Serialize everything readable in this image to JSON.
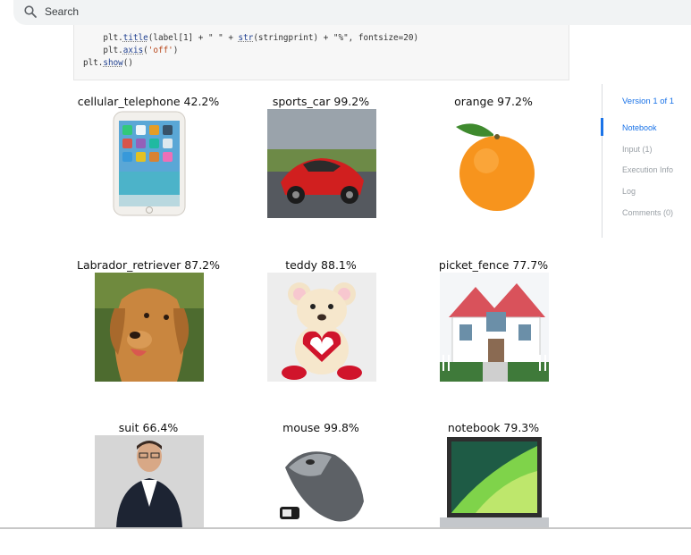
{
  "search": {
    "placeholder": "Search",
    "icon": "search-icon"
  },
  "code": {
    "line1": {
      "indent": "    ",
      "fn1": "plt.",
      "fn1b": "title",
      "rest1": "(label[1] + \" \" + ",
      "fn2": "str",
      "rest2": "(stringprint) + \"%\", fontsize=20)"
    },
    "line2": {
      "indent": "    ",
      "prefix": "plt.",
      "fn": "axis",
      "open": "(",
      "arg": "'off'",
      "close": ")"
    },
    "line3": {
      "prefix": "plt.",
      "fn": "show",
      "rest": "()"
    }
  },
  "predictions": [
    {
      "label": "cellular_telephone 42.2%",
      "image": "phone"
    },
    {
      "label": "sports_car 99.2%",
      "image": "car"
    },
    {
      "label": "orange 97.2%",
      "image": "orange"
    },
    {
      "label": "Labrador_retriever 87.2%",
      "image": "dog"
    },
    {
      "label": "teddy 88.1%",
      "image": "teddy"
    },
    {
      "label": "picket_fence 77.7%",
      "image": "house"
    },
    {
      "label": "suit 66.4%",
      "image": "person"
    },
    {
      "label": "mouse 99.8%",
      "image": "mouse"
    },
    {
      "label": "notebook 79.3%",
      "image": "laptop"
    }
  ],
  "nav": {
    "version": "Version 1 of 1",
    "items": [
      {
        "label": "Notebook",
        "active": true
      },
      {
        "label": "Input (1)",
        "active": false
      },
      {
        "label": "Execution Info",
        "active": false
      },
      {
        "label": "Log",
        "active": false
      },
      {
        "label": "Comments (0)",
        "active": false
      }
    ]
  },
  "colors": {
    "accent": "#1a73e8",
    "muted": "#9aa0a6"
  }
}
